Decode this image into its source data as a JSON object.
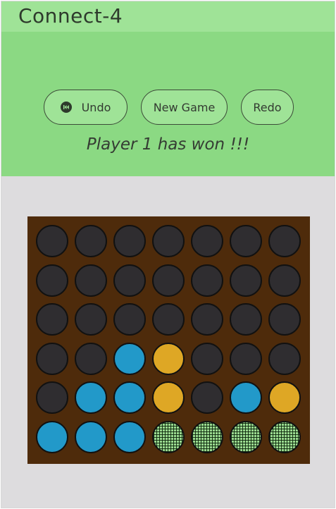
{
  "app": {
    "title": "Connect-4"
  },
  "controls": {
    "undo_label": "Undo",
    "undo_icon": "rewind-icon",
    "new_game_label": "New Game",
    "redo_label": "Redo"
  },
  "status": {
    "message": "Player 1 has won !!!"
  },
  "colors": {
    "header_background": "#8bd983",
    "page_background": "#dddcde",
    "board": "#4e2b0b",
    "empty_slot": "#2f2d30",
    "player1_disc": "#2299c9",
    "player2_disc": "#dea725",
    "winning_disc": "#9ad98f"
  },
  "board": {
    "rows": 6,
    "columns": 7,
    "cells": [
      [
        "empty",
        "empty",
        "empty",
        "empty",
        "empty",
        "empty",
        "empty"
      ],
      [
        "empty",
        "empty",
        "empty",
        "empty",
        "empty",
        "empty",
        "empty"
      ],
      [
        "empty",
        "empty",
        "empty",
        "empty",
        "empty",
        "empty",
        "empty"
      ],
      [
        "empty",
        "empty",
        "p1",
        "p2",
        "empty",
        "empty",
        "empty"
      ],
      [
        "empty",
        "p1",
        "p1",
        "p2",
        "empty",
        "p1",
        "p2"
      ],
      [
        "p1",
        "p1",
        "p1",
        "win",
        "win",
        "win",
        "win"
      ]
    ]
  }
}
